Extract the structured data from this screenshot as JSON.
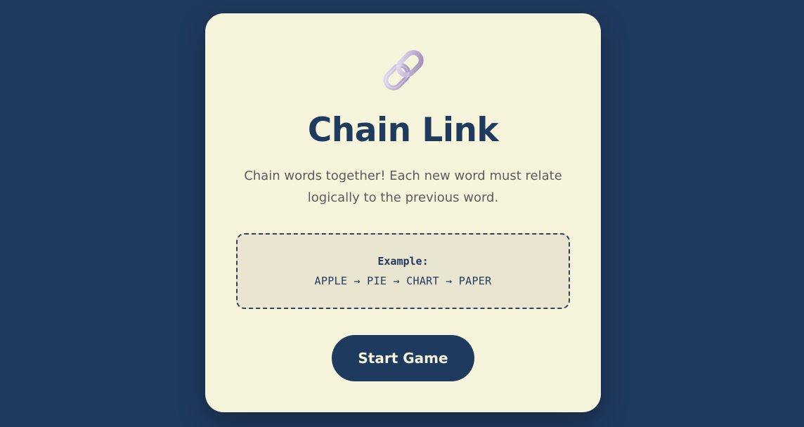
{
  "app": {
    "icon": "chain-link-icon",
    "title": "Chain Link",
    "description": "Chain words together! Each new word must relate logically to the previous word.",
    "example": {
      "label": "Example:",
      "chain": "APPLE → PIE → CHART → PAPER"
    },
    "start_button": "Start Game"
  },
  "colors": {
    "background": "#1f3a5f",
    "card": "#f6f5dc",
    "accent": "#1f3a5f",
    "example_box": "#e9e5d1"
  }
}
